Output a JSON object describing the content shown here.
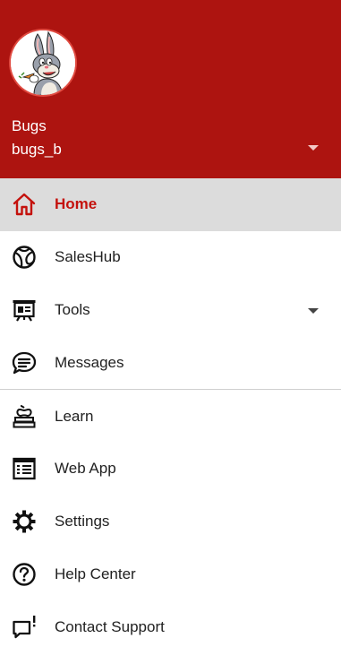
{
  "header": {
    "name": "Bugs",
    "handle": "bugs_b",
    "brand_color": "#ad1410"
  },
  "menu": {
    "items": [
      {
        "label": "Home",
        "icon": "home-icon",
        "active": true
      },
      {
        "label": "SalesHub",
        "icon": "globe-icon"
      },
      {
        "label": "Tools",
        "icon": "presentation-board-icon",
        "expandable": true
      },
      {
        "label": "Messages",
        "icon": "chat-bubble-icon"
      },
      {
        "label": "Learn",
        "icon": "book-stack-apple-icon"
      },
      {
        "label": "Web App",
        "icon": "browser-window-icon"
      },
      {
        "label": "Settings",
        "icon": "gear-icon"
      },
      {
        "label": "Help Center",
        "icon": "question-circle-icon"
      },
      {
        "label": "Contact Support",
        "icon": "support-chat-icon"
      }
    ]
  },
  "colors": {
    "active_text": "#c4120d",
    "active_background": "#dcdcdc"
  }
}
